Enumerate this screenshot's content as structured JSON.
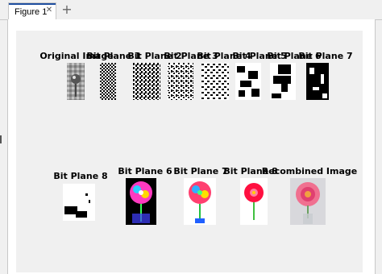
{
  "window": {
    "tab_label": "Figure 1",
    "tab_close_icon": "close-icon",
    "add_tab_icon": "plus-icon",
    "accent_color": "#1f4fa0"
  },
  "figure": {
    "row1_titles": [
      "Original Image",
      "Bit Plane 1",
      "Bit Plane 2",
      "Bit Plane 3",
      "Bit Plane 4",
      "Bit Plane 5",
      "Bit Plane 6",
      "Bit Plane 7"
    ],
    "row2_titles": [
      "Bit Plane 8",
      "Bit Plane 6",
      "Bit Plane 7",
      "Bit Plane 8",
      "Recombined Image"
    ]
  }
}
